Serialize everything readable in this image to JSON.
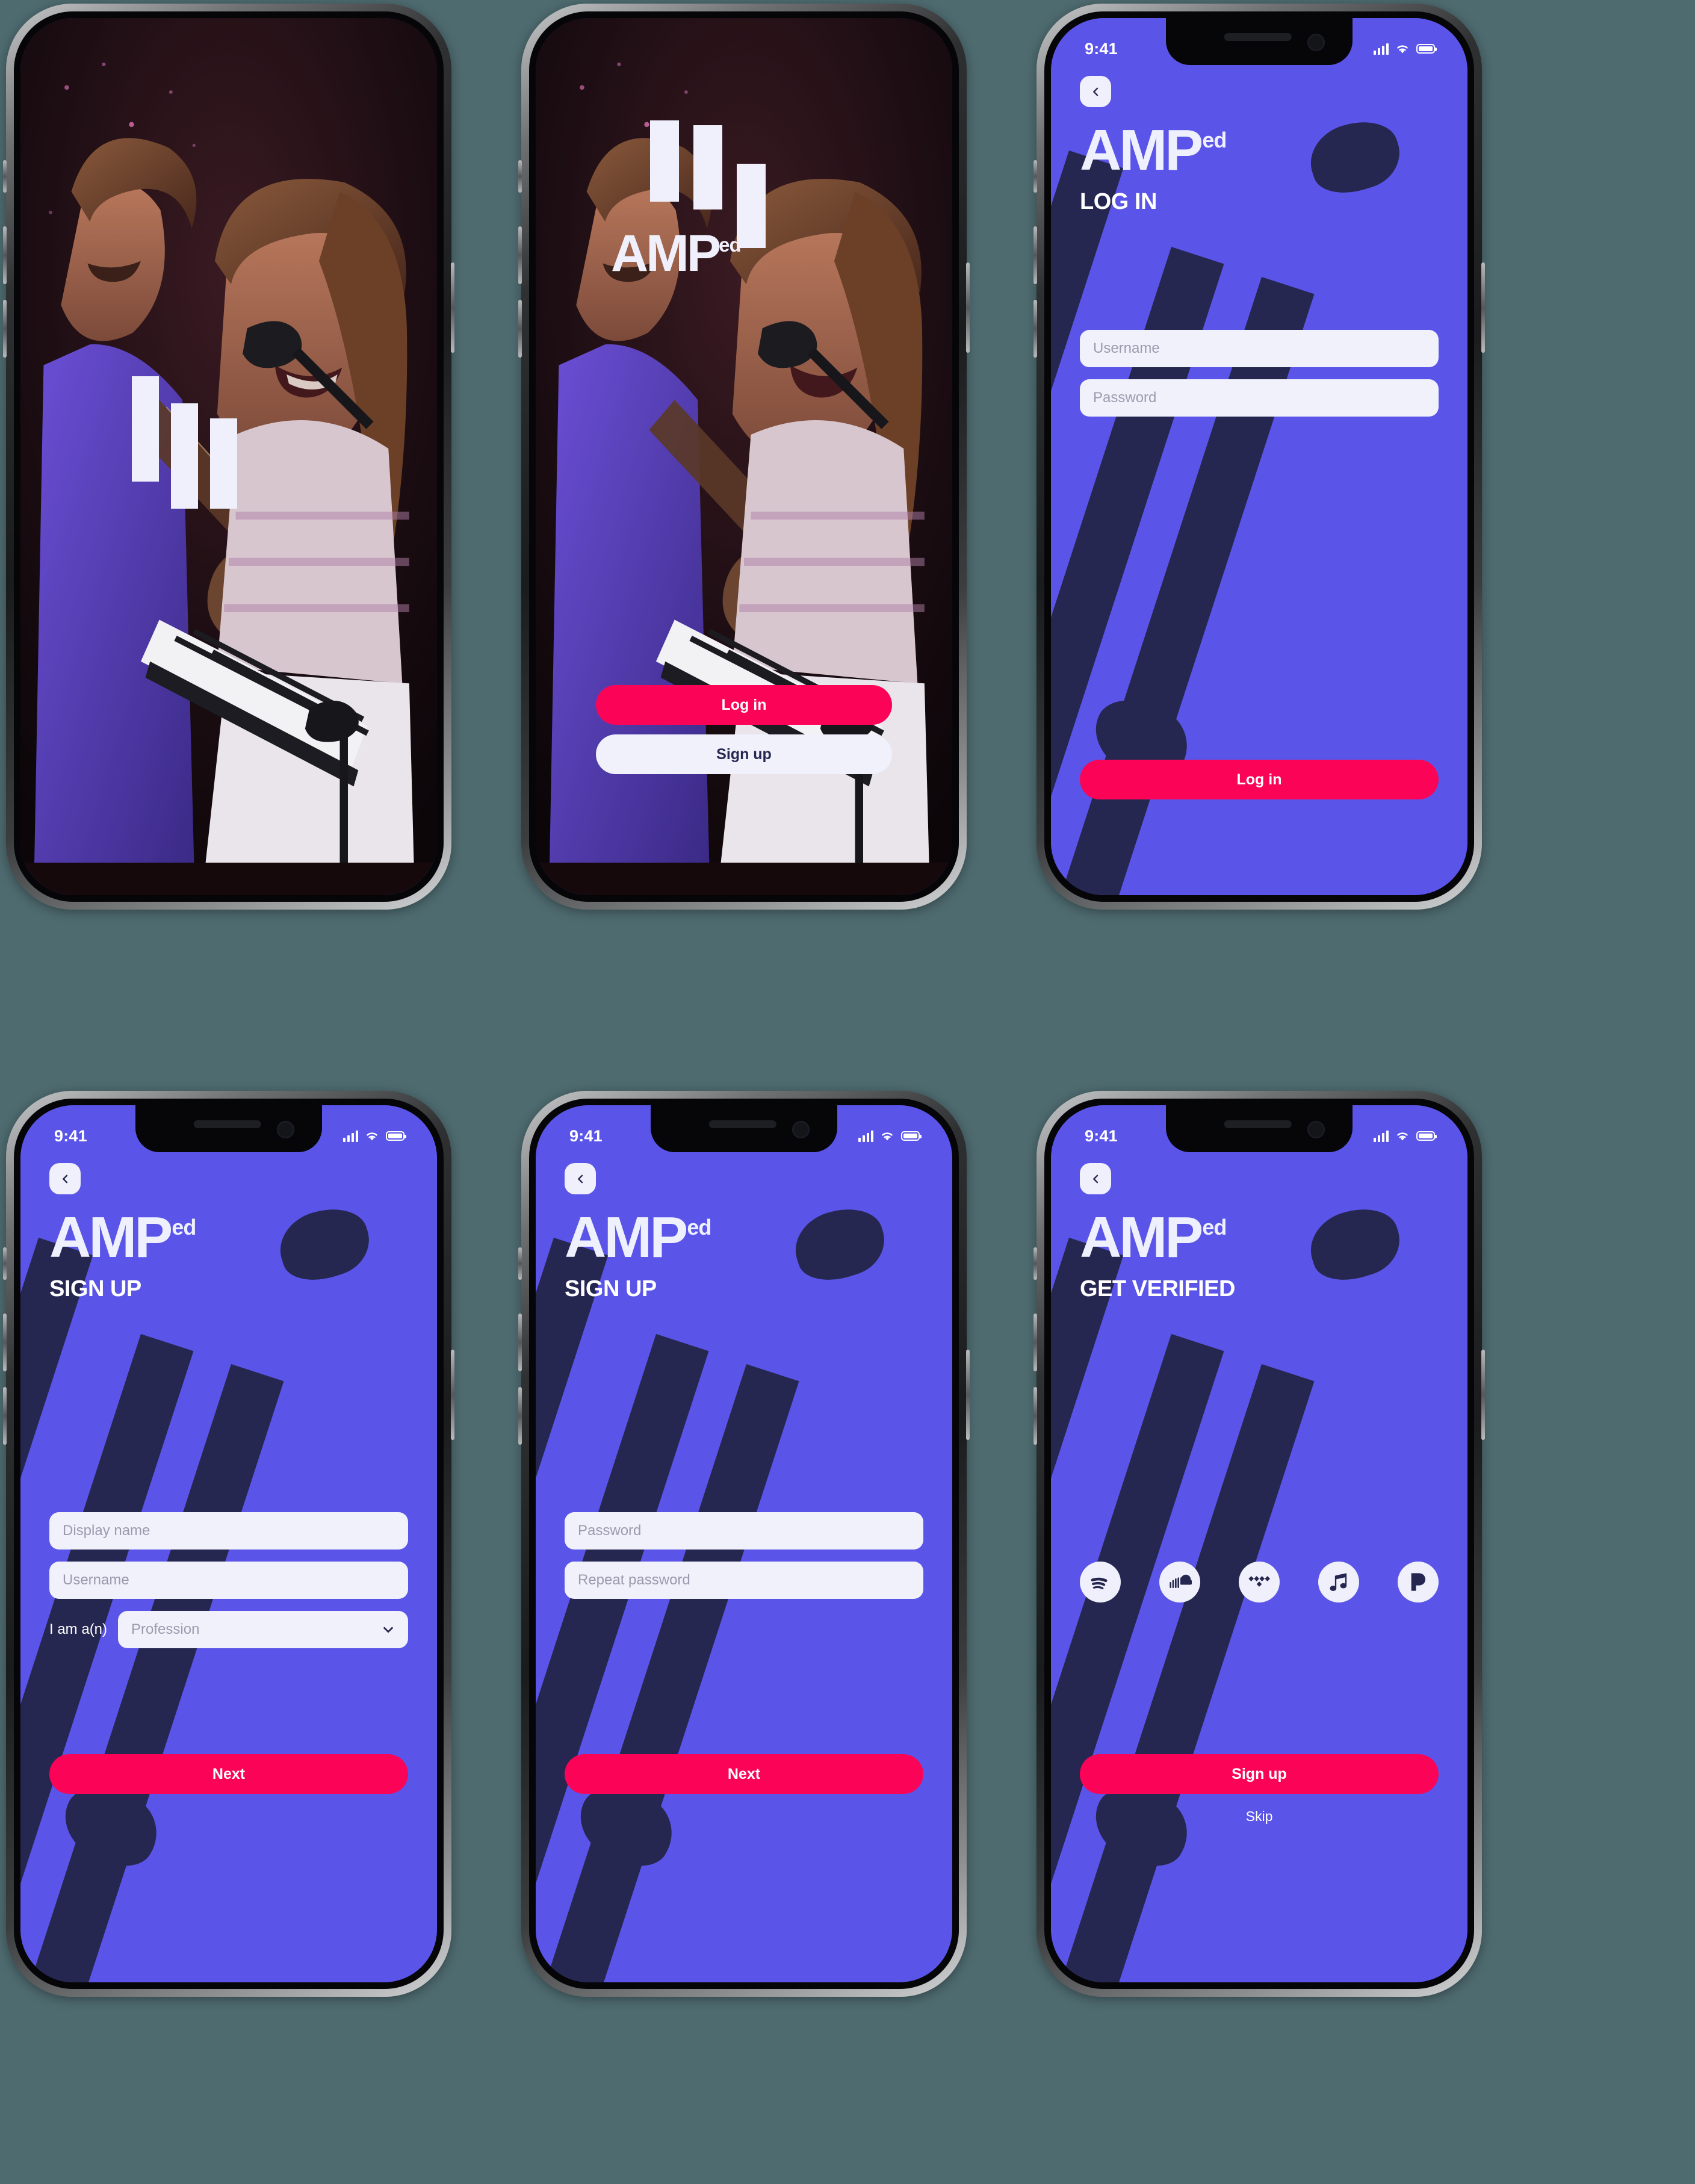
{
  "brand": {
    "name": "AMP",
    "suffix": "ed"
  },
  "colors": {
    "purple": "#5a55e8",
    "navy": "#262750",
    "pink": "#fb0458",
    "offwhite": "#f0f1fb",
    "placeholder": "#9a9cae"
  },
  "status_bar": {
    "time": "9:41",
    "signal_icon": "cellular-signal-icon",
    "wifi_icon": "wifi-icon",
    "battery_icon": "battery-icon"
  },
  "screens": [
    {
      "id": "splash",
      "type": "photo",
      "name": "splash-screen",
      "logo_bars": true
    },
    {
      "id": "welcome",
      "type": "photo",
      "name": "welcome-screen",
      "logo_bars": true,
      "buttons": [
        {
          "label": "Log in",
          "style": "primary",
          "name": "login-button"
        },
        {
          "label": "Sign up",
          "style": "light",
          "name": "signup-button"
        }
      ]
    },
    {
      "id": "login",
      "type": "purple",
      "name": "login-screen",
      "subtitle": "LOG IN",
      "back_icon": "chevron-left-icon",
      "fields": [
        {
          "placeholder": "Username",
          "name": "username-input"
        },
        {
          "placeholder": "Password",
          "name": "password-input"
        }
      ],
      "cta": {
        "label": "Log in",
        "name": "login-submit-button"
      }
    },
    {
      "id": "signup-1",
      "type": "purple",
      "name": "signup-step1-screen",
      "subtitle": "SIGN UP",
      "back_icon": "chevron-left-icon",
      "fields": [
        {
          "placeholder": "Display name",
          "name": "display-name-input"
        },
        {
          "placeholder": "Username",
          "name": "username-input"
        }
      ],
      "profession_row": {
        "label": "I am a(n)",
        "placeholder": "Profession",
        "chevron_icon": "chevron-down-icon",
        "name": "profession-select"
      },
      "cta": {
        "label": "Next",
        "name": "next-button"
      }
    },
    {
      "id": "signup-2",
      "type": "purple",
      "name": "signup-step2-screen",
      "subtitle": "SIGN UP",
      "back_icon": "chevron-left-icon",
      "fields": [
        {
          "placeholder": "Password",
          "name": "password-input"
        },
        {
          "placeholder": "Repeat password",
          "name": "repeat-password-input"
        }
      ],
      "cta": {
        "label": "Next",
        "name": "next-button"
      }
    },
    {
      "id": "verify",
      "type": "purple",
      "name": "get-verified-screen",
      "subtitle": "GET VERIFIED",
      "back_icon": "chevron-left-icon",
      "services": [
        {
          "name": "spotify-icon",
          "label": "Spotify"
        },
        {
          "name": "soundcloud-icon",
          "label": "SoundCloud"
        },
        {
          "name": "tidal-icon",
          "label": "Tidal"
        },
        {
          "name": "apple-music-icon",
          "label": "Apple Music"
        },
        {
          "name": "pandora-icon",
          "label": "Pandora"
        }
      ],
      "cta": {
        "label": "Sign up",
        "name": "signup-submit-button"
      },
      "skip": {
        "label": "Skip",
        "name": "skip-link"
      }
    }
  ]
}
